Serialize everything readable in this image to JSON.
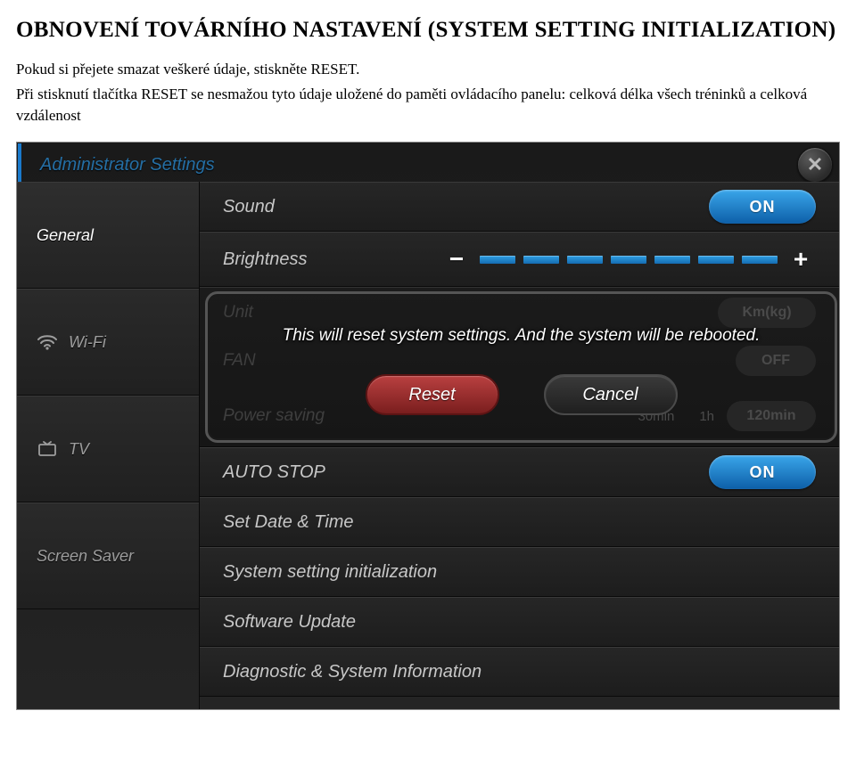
{
  "doc": {
    "title": "OBNOVENÍ TOVÁRNÍHO NASTAVENÍ (SYSTEM SETTING INITIALIZATION)",
    "p1": "Pokud si přejete smazat veškeré údaje, stiskněte RESET.",
    "p2": "Při stisknutí tlačítka RESET se nesmažou tyto údaje uložené do paměti ovládacího panelu: celková délka všech tréninků a celková vzdálenost"
  },
  "header": {
    "title": "Administrator Settings"
  },
  "sidebar": {
    "items": [
      {
        "label": "General"
      },
      {
        "label": "Wi-Fi"
      },
      {
        "label": "TV"
      },
      {
        "label": "Screen Saver"
      }
    ]
  },
  "settings": {
    "sound": {
      "label": "Sound",
      "value": "ON"
    },
    "brightness": {
      "label": "Brightness"
    },
    "unit": {
      "label": "Unit",
      "value": "Km(kg)"
    },
    "fan": {
      "label": "FAN",
      "value": "OFF"
    },
    "power_saving": {
      "label": "Power saving",
      "opt1": "30min",
      "opt2": "1h",
      "opt3": "120min"
    },
    "auto_stop": {
      "label": "AUTO STOP",
      "value": "ON"
    },
    "set_date": {
      "label": "Set Date & Time"
    },
    "sys_init": {
      "label": "System setting initialization"
    },
    "sw_update": {
      "label": "Software Update"
    },
    "diag": {
      "label": "Diagnostic & System Information"
    }
  },
  "dialog": {
    "message": "This will reset system settings. And the system will be rebooted.",
    "reset": "Reset",
    "cancel": "Cancel"
  }
}
